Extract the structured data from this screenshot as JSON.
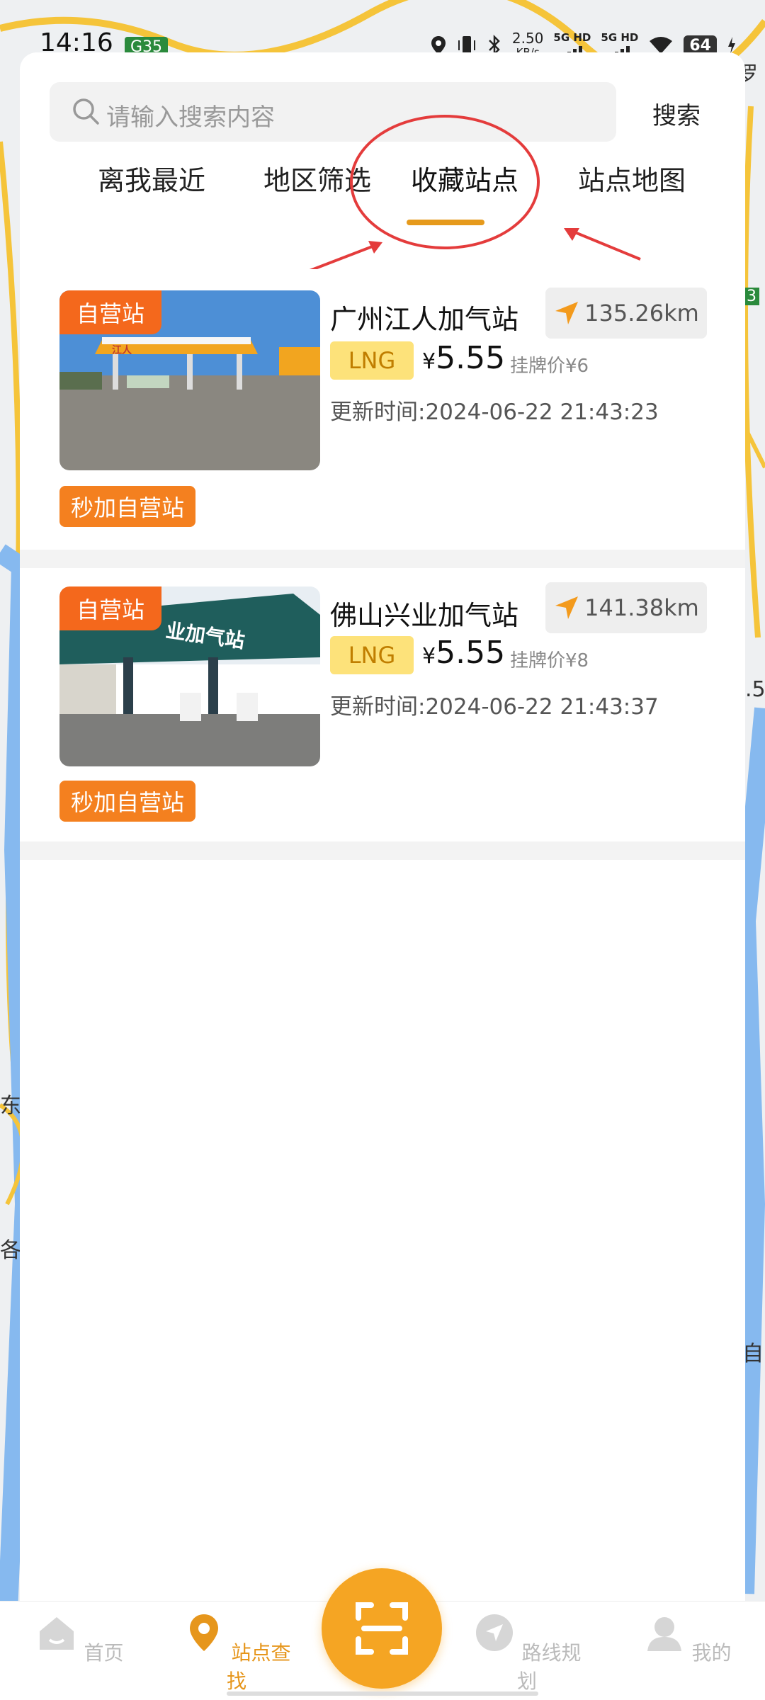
{
  "status_bar": {
    "time": "14:16",
    "highway_badge": "G35",
    "speed_value": "2.50",
    "speed_unit": "KB/s",
    "net1": "5G HD",
    "net2": "5G HD",
    "battery": "64"
  },
  "map": {
    "labels": [
      "罗",
      "3",
      ".5",
      "东海",
      "各",
      "自"
    ]
  },
  "search": {
    "placeholder": "请输入搜索内容",
    "button_label": "搜索"
  },
  "tabs": [
    {
      "label": "离我最近",
      "active": false
    },
    {
      "label": "地区筛选",
      "active": false
    },
    {
      "label": "收藏站点",
      "active": true
    },
    {
      "label": "站点地图",
      "active": false
    }
  ],
  "stations": [
    {
      "self_operated_tag": "自营站",
      "name": "广州江人加气站",
      "distance": "135.26km",
      "fuel_type": "LNG",
      "price_symbol": "¥",
      "price": "5.55",
      "list_price": "挂牌价¥6",
      "update_time": "更新时间:2024-06-22 21:43:23",
      "bonus_tag": "秒加自营站",
      "photo_sign": "江人"
    },
    {
      "self_operated_tag": "自营站",
      "name": "佛山兴业加气站",
      "distance": "141.38km",
      "fuel_type": "LNG",
      "price_symbol": "¥",
      "price": "5.55",
      "list_price": "挂牌价¥8",
      "update_time": "更新时间:2024-06-22 21:43:37",
      "bonus_tag": "秒加自营站",
      "photo_sign": "业加气站"
    }
  ],
  "bottom_nav": [
    {
      "label": "首页",
      "icon": "home-icon",
      "active": false
    },
    {
      "label": "站点查找",
      "icon": "location-pin-icon",
      "active": true
    },
    {
      "label": "路线规划",
      "icon": "navigation-icon",
      "active": false
    },
    {
      "label": "我的",
      "icon": "user-icon",
      "active": false
    }
  ],
  "colors": {
    "accent": "#e6961c",
    "self_tag": "#f4681c",
    "bonus_tag": "#f4801f",
    "highlight": "#e43c3c",
    "lng_bg": "#fde27a"
  }
}
